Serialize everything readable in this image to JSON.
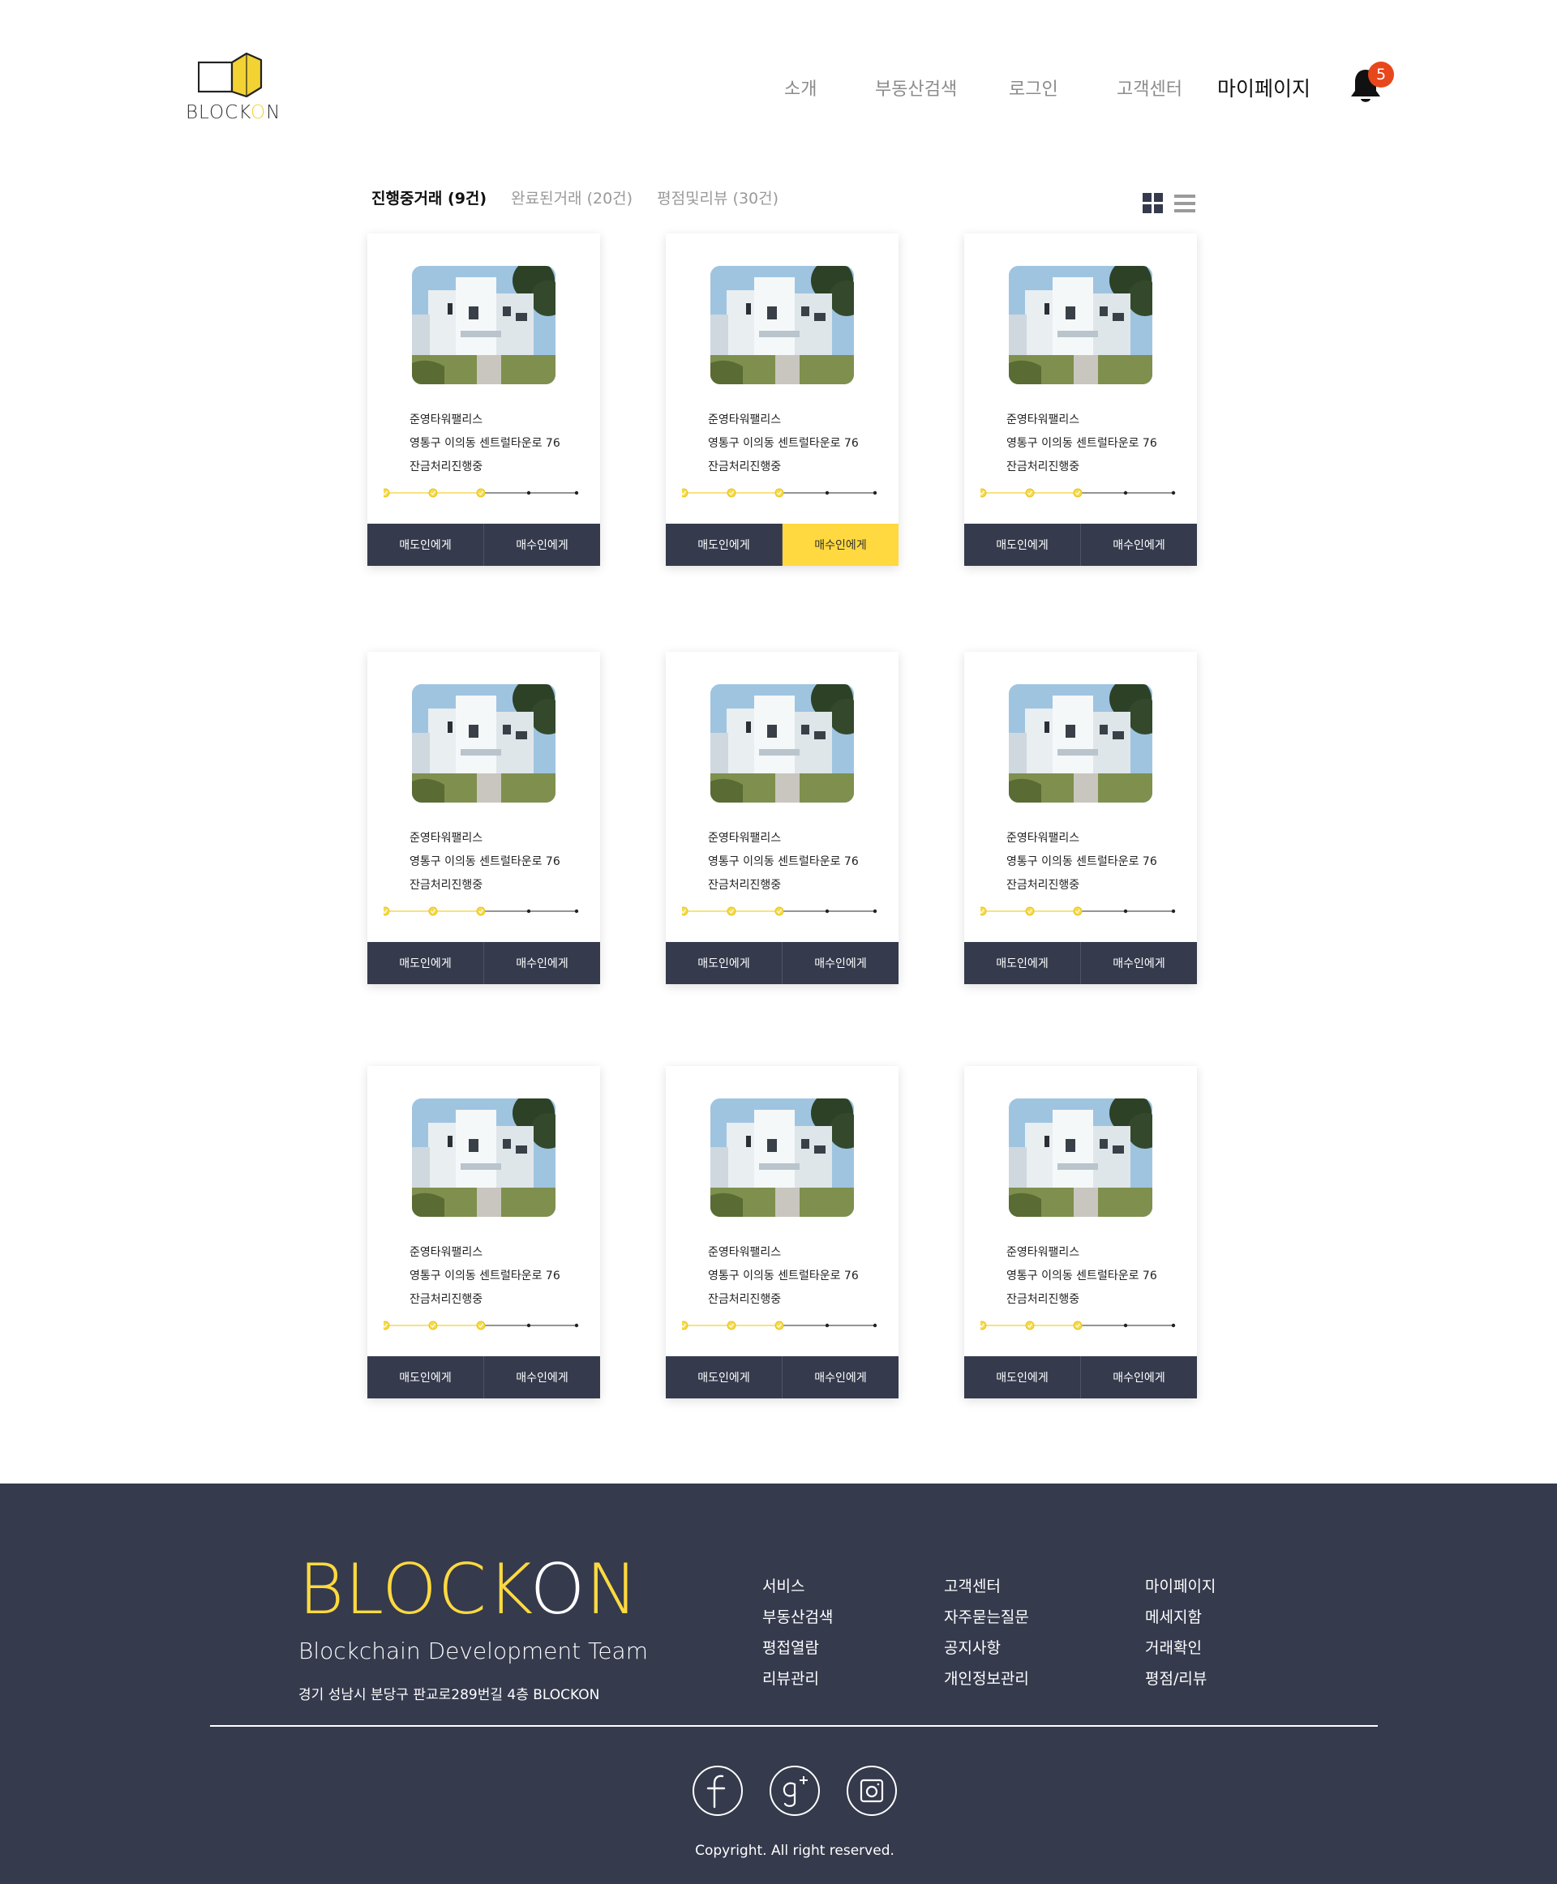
{
  "header": {
    "logo_text": "BLOCKON",
    "nav": [
      "소개",
      "부동산검색",
      "로그인",
      "고객센터",
      "마이페이지"
    ],
    "notification_count": "5"
  },
  "tabs": [
    "진행중거래 (9건)",
    "완료된거래 (20건)",
    "평점및리뷰 (30건)"
  ],
  "view_modes": [
    "grid-view",
    "list-view"
  ],
  "cards": [
    {
      "name": "준영타워팰리스",
      "address": "영통구 이의동 센트럴타운로 76",
      "status": "잔금처리진행중",
      "progress_completed_steps": 3,
      "progress_total_steps": 5,
      "seller_label": "매도인에게",
      "buyer_label": "매수인에게",
      "highlight": ""
    },
    {
      "name": "준영타워팰리스",
      "address": "영통구 이의동 센트럴타운로 76",
      "status": "잔금처리진행중",
      "progress_completed_steps": 3,
      "progress_total_steps": 5,
      "seller_label": "매도인에게",
      "buyer_label": "매수인에게",
      "highlight": "buyer"
    },
    {
      "name": "준영타워팰리스",
      "address": "영통구 이의동 센트럴타운로 76",
      "status": "잔금처리진행중",
      "progress_completed_steps": 3,
      "progress_total_steps": 5,
      "seller_label": "매도인에게",
      "buyer_label": "매수인에게",
      "highlight": ""
    },
    {
      "name": "준영타워팰리스",
      "address": "영통구 이의동 센트럴타운로 76",
      "status": "잔금처리진행중",
      "progress_completed_steps": 3,
      "progress_total_steps": 5,
      "seller_label": "매도인에게",
      "buyer_label": "매수인에게",
      "highlight": ""
    },
    {
      "name": "준영타워팰리스",
      "address": "영통구 이의동 센트럴타운로 76",
      "status": "잔금처리진행중",
      "progress_completed_steps": 3,
      "progress_total_steps": 5,
      "seller_label": "매도인에게",
      "buyer_label": "매수인에게",
      "highlight": ""
    },
    {
      "name": "준영타워팰리스",
      "address": "영통구 이의동 센트럴타운로 76",
      "status": "잔금처리진행중",
      "progress_completed_steps": 3,
      "progress_total_steps": 5,
      "seller_label": "매도인에게",
      "buyer_label": "매수인에게",
      "highlight": ""
    },
    {
      "name": "준영타워팰리스",
      "address": "영통구 이의동 센트럴타운로 76",
      "status": "잔금처리진행중",
      "progress_completed_steps": 3,
      "progress_total_steps": 5,
      "seller_label": "매도인에게",
      "buyer_label": "매수인에게",
      "highlight": ""
    },
    {
      "name": "준영타워팰리스",
      "address": "영통구 이의동 센트럴타운로 76",
      "status": "잔금처리진행중",
      "progress_completed_steps": 3,
      "progress_total_steps": 5,
      "seller_label": "매도인에게",
      "buyer_label": "매수인에게",
      "highlight": ""
    },
    {
      "name": "준영타워팰리스",
      "address": "영통구 이의동 센트럴타운로 76",
      "status": "잔금처리진행중",
      "progress_completed_steps": 3,
      "progress_total_steps": 5,
      "seller_label": "매도인에게",
      "buyer_label": "매수인에게",
      "highlight": ""
    }
  ],
  "footer": {
    "logo": "BLOCKON",
    "team": "Blockchain Development Team",
    "address": "경기 성남시 분당구 판교로289번길 4층 BLOCKON",
    "columns": [
      [
        "서비스",
        "부동산검색",
        "평접열람",
        "리뷰관리"
      ],
      [
        "고객센터",
        "자주묻는질문",
        "공지사항",
        "개인정보관리"
      ],
      [
        "마이페이지",
        "메세지함",
        "거래확인",
        "평점/리뷰"
      ]
    ],
    "social": [
      "facebook-icon",
      "google-plus-icon",
      "instagram-icon"
    ],
    "copyright": "Copyright. All right reserved."
  },
  "colors": {
    "accent": "#ffd93f",
    "navy": "#353a4d",
    "badge": "#e8471c"
  }
}
